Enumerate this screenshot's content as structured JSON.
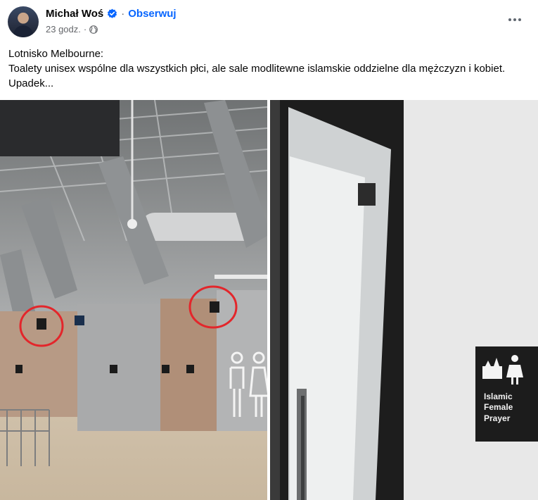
{
  "post": {
    "author": "Michał Woś",
    "follow_label": "Obserwuj",
    "separator": "·",
    "timestamp": "23 godz.",
    "meta_separator": "·",
    "text_line_1": "Lotnisko Melbourne:",
    "text_line_2": "Toalety unisex wspólne dla wszystkich płci, ale sale modlitewne islamskie oddzielne dla mężczyzn i kobiet.  Upadek...",
    "icons": {
      "verified": "verified-badge-icon",
      "privacy": "globe-icon",
      "more": "more-options-icon"
    }
  },
  "photos": {
    "right_sign": {
      "line_1": "Islamic",
      "line_2": "Female",
      "line_3": "Prayer"
    }
  },
  "colors": {
    "accent": "#0866ff",
    "secondary_text": "#65676b",
    "highlight_circle": "#e3262b"
  }
}
